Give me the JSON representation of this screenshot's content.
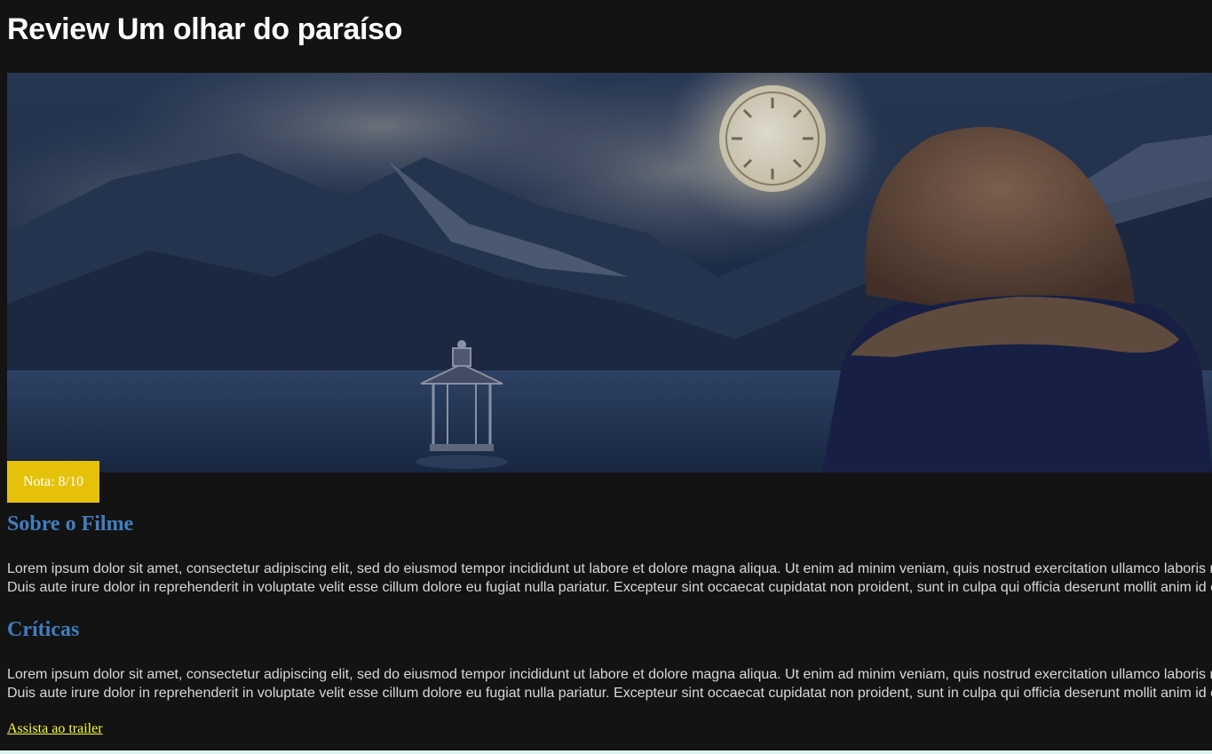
{
  "page": {
    "title": "Review Um olhar do paraíso"
  },
  "hero_image": {
    "description_icon": "movie-banner-image"
  },
  "rating": {
    "label": "Nota: 8/10"
  },
  "sections": {
    "about": {
      "heading": "Sobre o Filme",
      "line1": "Lorem ipsum dolor sit amet, consectetur adipiscing elit, sed do eiusmod tempor incididunt ut labore et dolore magna aliqua. Ut enim ad minim veniam, quis nostrud exercitation ullamco laboris nisi ut aliquip ex ea commodo consequat.",
      "line2": "Duis aute irure dolor in reprehenderit in voluptate velit esse cillum dolore eu fugiat nulla pariatur. Excepteur sint occaecat cupidatat non proident, sunt in culpa qui officia deserunt mollit anim id est laborum."
    },
    "reviews": {
      "heading": "Críticas",
      "line1": "Lorem ipsum dolor sit amet, consectetur adipiscing elit, sed do eiusmod tempor incididunt ut labore et dolore magna aliqua. Ut enim ad minim veniam, quis nostrud exercitation ullamco laboris nisi ut aliquip ex ea commodo consequat.",
      "line2": "Duis aute irure dolor in reprehenderit in voluptate velit esse cillum dolore eu fugiat nulla pariatur. Excepteur sint occaecat cupidatat non proident, sunt in culpa qui officia deserunt mollit anim id est laborum."
    }
  },
  "trailer": {
    "link_text": "Assista ao trailer"
  },
  "colors": {
    "background": "#131313",
    "heading_blue": "#3f7fbf",
    "badge_yellow": "#e5c10c",
    "link_yellow": "#ffff33"
  }
}
